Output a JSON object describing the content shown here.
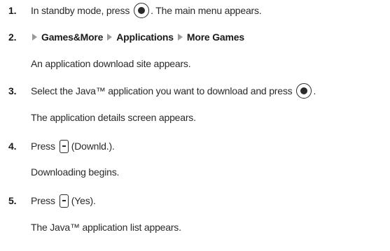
{
  "steps": [
    {
      "number": "1.",
      "text_before_key": "In standby mode, press",
      "text_after_key": ". The main menu appears."
    },
    {
      "number": "2.",
      "menu_path": [
        "Games&More",
        "Applications",
        "More Games"
      ],
      "note": "An application download site appears."
    },
    {
      "number": "3.",
      "text_before_key": "Select the Java™ application you want to download and press",
      "text_after_key": ".",
      "note": "The application details screen appears."
    },
    {
      "number": "4.",
      "text_before_key": "Press",
      "text_after_key": "(Downld.).",
      "note": "Downloading begins."
    },
    {
      "number": "5.",
      "text_before_key": "Press",
      "text_after_key": "(Yes).",
      "note": "The Java™ application list appears."
    }
  ],
  "icons": {
    "center_key": "center-select-key-icon",
    "soft_key": "left-soft-key-icon",
    "menu_arrow": "menu-arrow-icon"
  },
  "colors": {
    "text": "#2a2a2a",
    "arrow": "#9a9a9a"
  }
}
